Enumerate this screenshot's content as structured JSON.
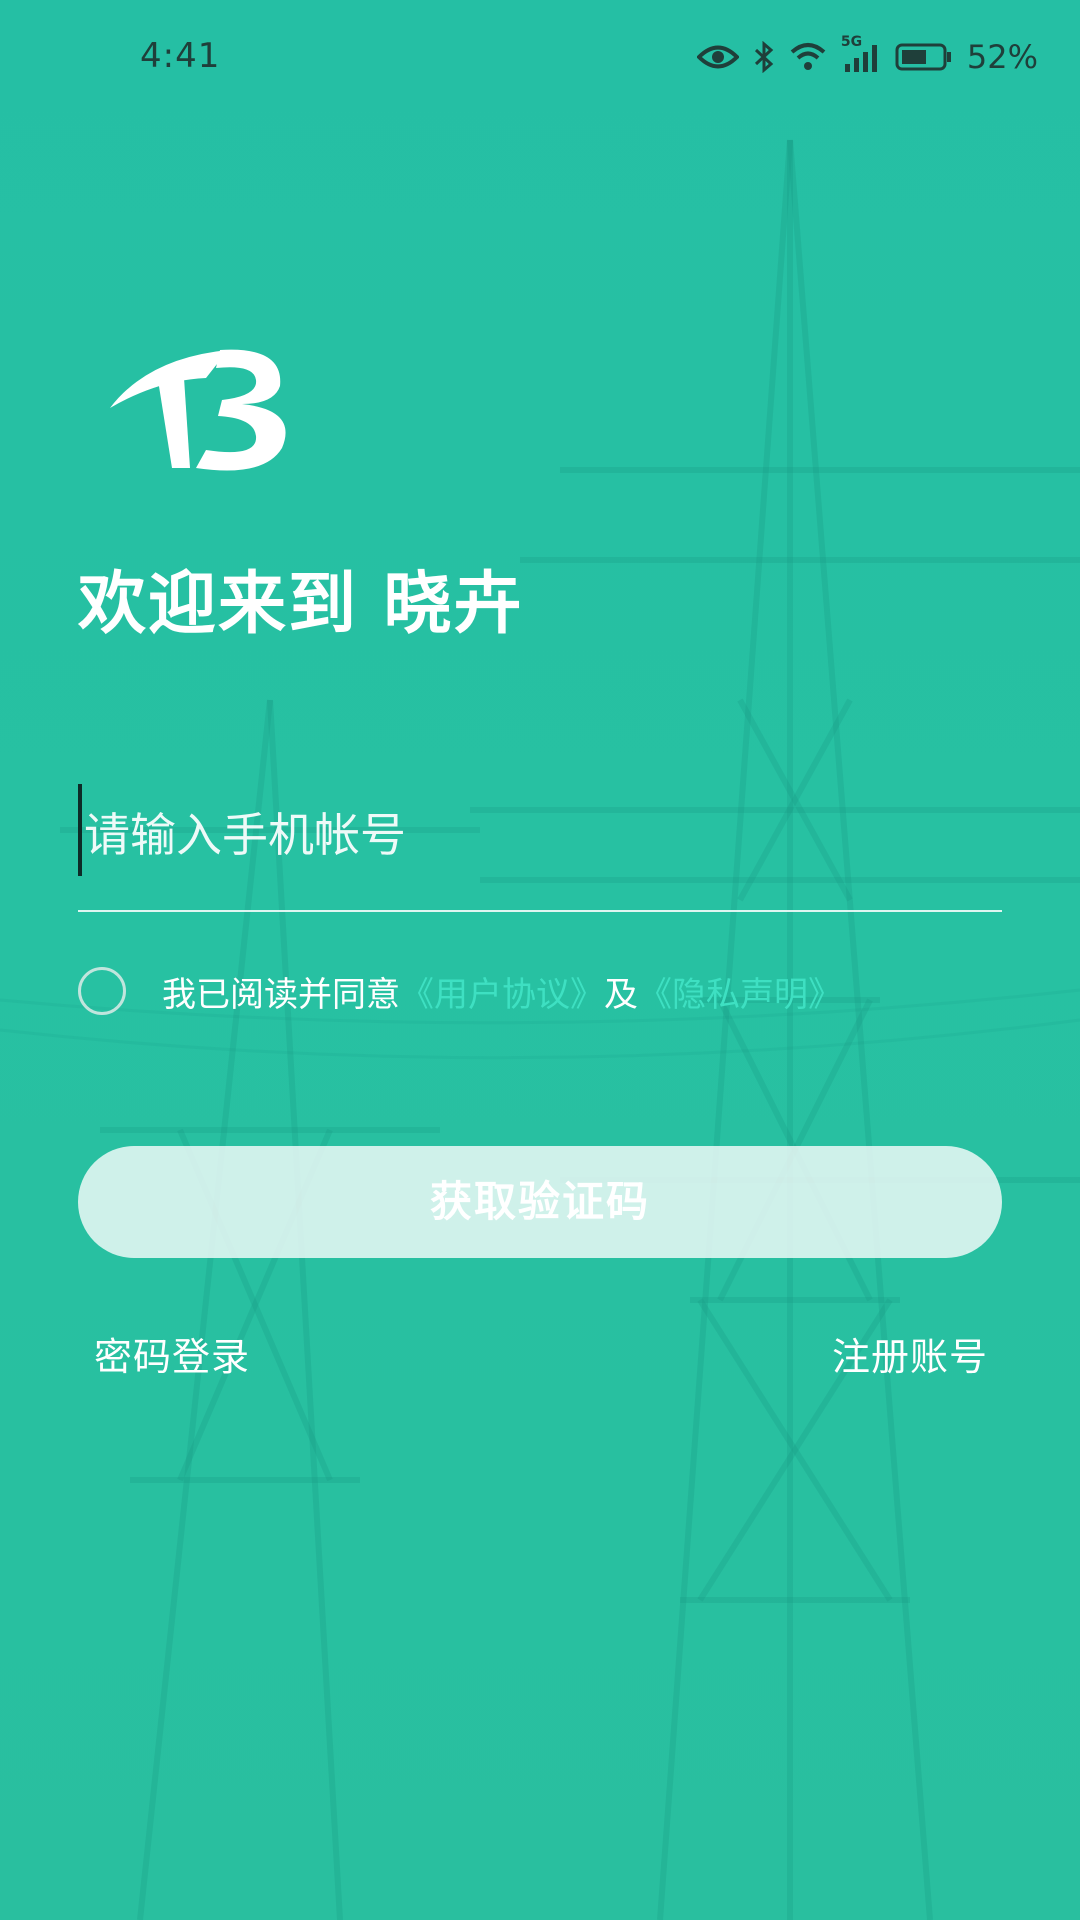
{
  "status_bar": {
    "time": "4:41",
    "network": "5G",
    "battery": "52%",
    "icons": [
      "eye-icon",
      "bluetooth-icon",
      "wifi-icon",
      "signal-icon",
      "battery-icon"
    ]
  },
  "logo": {
    "icon": "tb-logo",
    "color": "#ffffff"
  },
  "welcome_title": "欢迎来到 晓卉",
  "phone_input": {
    "placeholder": "请输入手机帐号",
    "value": ""
  },
  "agreement": {
    "checked": false,
    "prefix": "我已阅读并同意",
    "user_agreement": "《用户协议》",
    "and": "及",
    "privacy": "《隐私声明》"
  },
  "primary_button": {
    "label": "获取验证码"
  },
  "links": {
    "password_login": "密码登录",
    "register": "注册账号"
  },
  "colors": {
    "background": "#27c1a2",
    "link": "#3ee0c2",
    "button_bg": "#cdeee7",
    "text": "#ffffff"
  }
}
